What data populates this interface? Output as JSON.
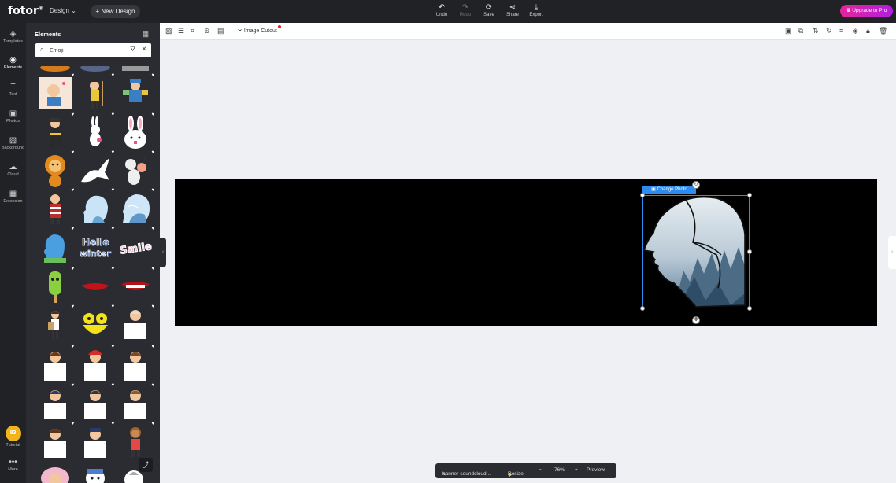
{
  "app": {
    "logo": "fotor",
    "logo_mark": "®"
  },
  "topbar": {
    "design_label": "Design",
    "new_design_label": "+ New Design",
    "actions": [
      {
        "label": "Undo",
        "icon": "undo-icon",
        "glyph": "↶",
        "enabled": true
      },
      {
        "label": "Redo",
        "icon": "redo-icon",
        "glyph": "↷",
        "enabled": false
      },
      {
        "label": "Save",
        "icon": "save-sync-icon",
        "glyph": "⟳",
        "enabled": true
      },
      {
        "label": "Share",
        "icon": "share-icon",
        "glyph": "⋖",
        "enabled": true
      },
      {
        "label": "Export",
        "icon": "download-icon",
        "glyph": "⤓",
        "enabled": true
      }
    ],
    "upgrade_label": "Upgrade to Pro",
    "upgrade_colors": [
      "#e5259a",
      "#b21ee0"
    ]
  },
  "rail": {
    "items": [
      {
        "label": "Templates",
        "icon": "templates-icon",
        "glyph": "◈"
      },
      {
        "label": "Elements",
        "icon": "elements-icon",
        "glyph": "◉",
        "active": true
      },
      {
        "label": "Text",
        "icon": "text-icon",
        "glyph": "T"
      },
      {
        "label": "Photos",
        "icon": "photos-icon",
        "glyph": "▣"
      },
      {
        "label": "Background",
        "icon": "background-icon",
        "glyph": "▨"
      },
      {
        "label": "Cloud",
        "icon": "cloud-icon",
        "glyph": "☁"
      },
      {
        "label": "Extension",
        "icon": "extension-icon",
        "glyph": "▦"
      }
    ],
    "tutorial_label": "Tutorial",
    "tutorial_badge": "83",
    "more_label": "More"
  },
  "panel": {
    "title": "Elements",
    "search_value": "Emoji"
  },
  "toolbar": {
    "image_cutout_label": "Image Cutout"
  },
  "canvas": {
    "background": "#000000",
    "change_photo_label": "Change Photo"
  },
  "bottombar": {
    "filename": "banner-soundcloud...",
    "resize_label": "Resize",
    "zoom_minus": "−",
    "zoom": "76%",
    "zoom_plus": "+",
    "preview_label": "Preview"
  },
  "colors": {
    "accent": "#2d8cf0",
    "dark": "#212226",
    "panel": "#2b2c31"
  }
}
